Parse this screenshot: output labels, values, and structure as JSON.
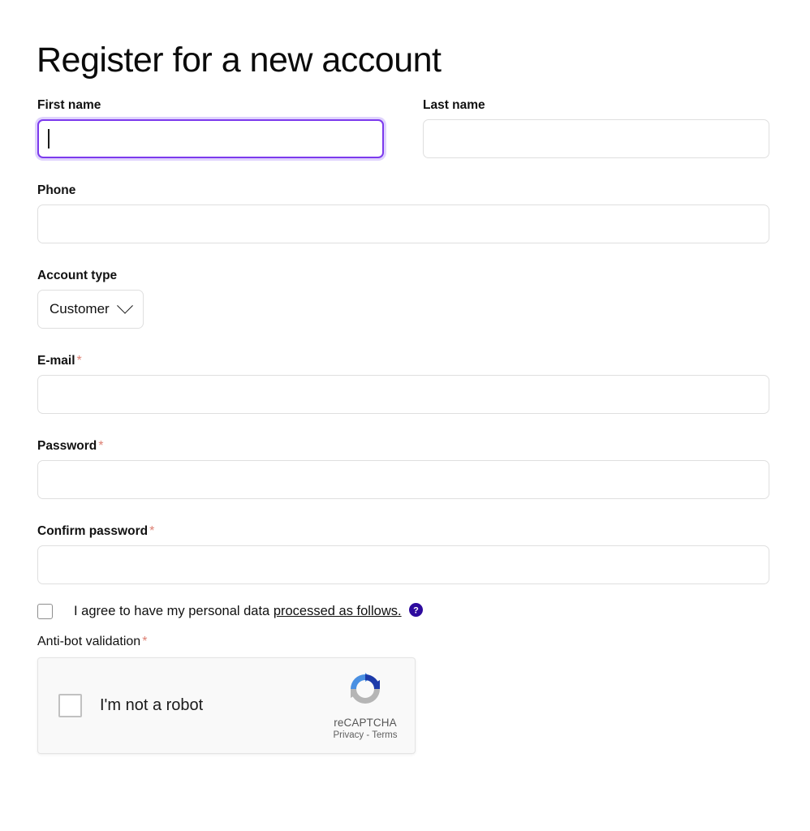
{
  "page": {
    "title": "Register for a new account"
  },
  "colors": {
    "focus_border": "#7c3aed",
    "required_asterisk": "#dd7f72",
    "help_icon": "#2e0b9e",
    "recaptcha_blue_light": "#4a90e2",
    "recaptcha_blue_dark": "#1c3aa9",
    "recaptcha_gray": "#b5b5b5",
    "input_border": "#dfdfdf"
  },
  "form": {
    "fields": {
      "first_name": {
        "label": "First name",
        "required_mark": "",
        "value": "",
        "placeholder": "",
        "focused": true
      },
      "last_name": {
        "label": "Last name",
        "required_mark": "",
        "value": "",
        "placeholder": "",
        "focused": false
      },
      "phone": {
        "label": "Phone",
        "required_mark": "",
        "value": "",
        "placeholder": "",
        "focused": false
      },
      "account_type": {
        "label": "Account type",
        "required_mark": "",
        "selected": "Customer",
        "chevron_icon": "chevron-down-icon"
      },
      "email": {
        "label": "E-mail",
        "required_mark": "*",
        "value": "",
        "placeholder": "",
        "focused": false
      },
      "password": {
        "label": "Password",
        "required_mark": "*",
        "value": "",
        "placeholder": "",
        "focused": false
      },
      "confirm_password": {
        "label": "Confirm password",
        "required_mark": "*",
        "value": "",
        "placeholder": "",
        "focused": false
      }
    },
    "consent": {
      "checked": false,
      "text_before": "I agree to have my personal data",
      "link_text": "processed as follows.",
      "help_icon": "help-circle-icon"
    },
    "antibot": {
      "label": "Anti-bot validation",
      "required_mark": "*",
      "recaptcha": {
        "checkbox_checked": false,
        "checkbox_label": "I'm not a robot",
        "brand_name": "reCAPTCHA",
        "legal": "Privacy - Terms",
        "logo_icon": "recaptcha-logo-icon"
      }
    }
  }
}
